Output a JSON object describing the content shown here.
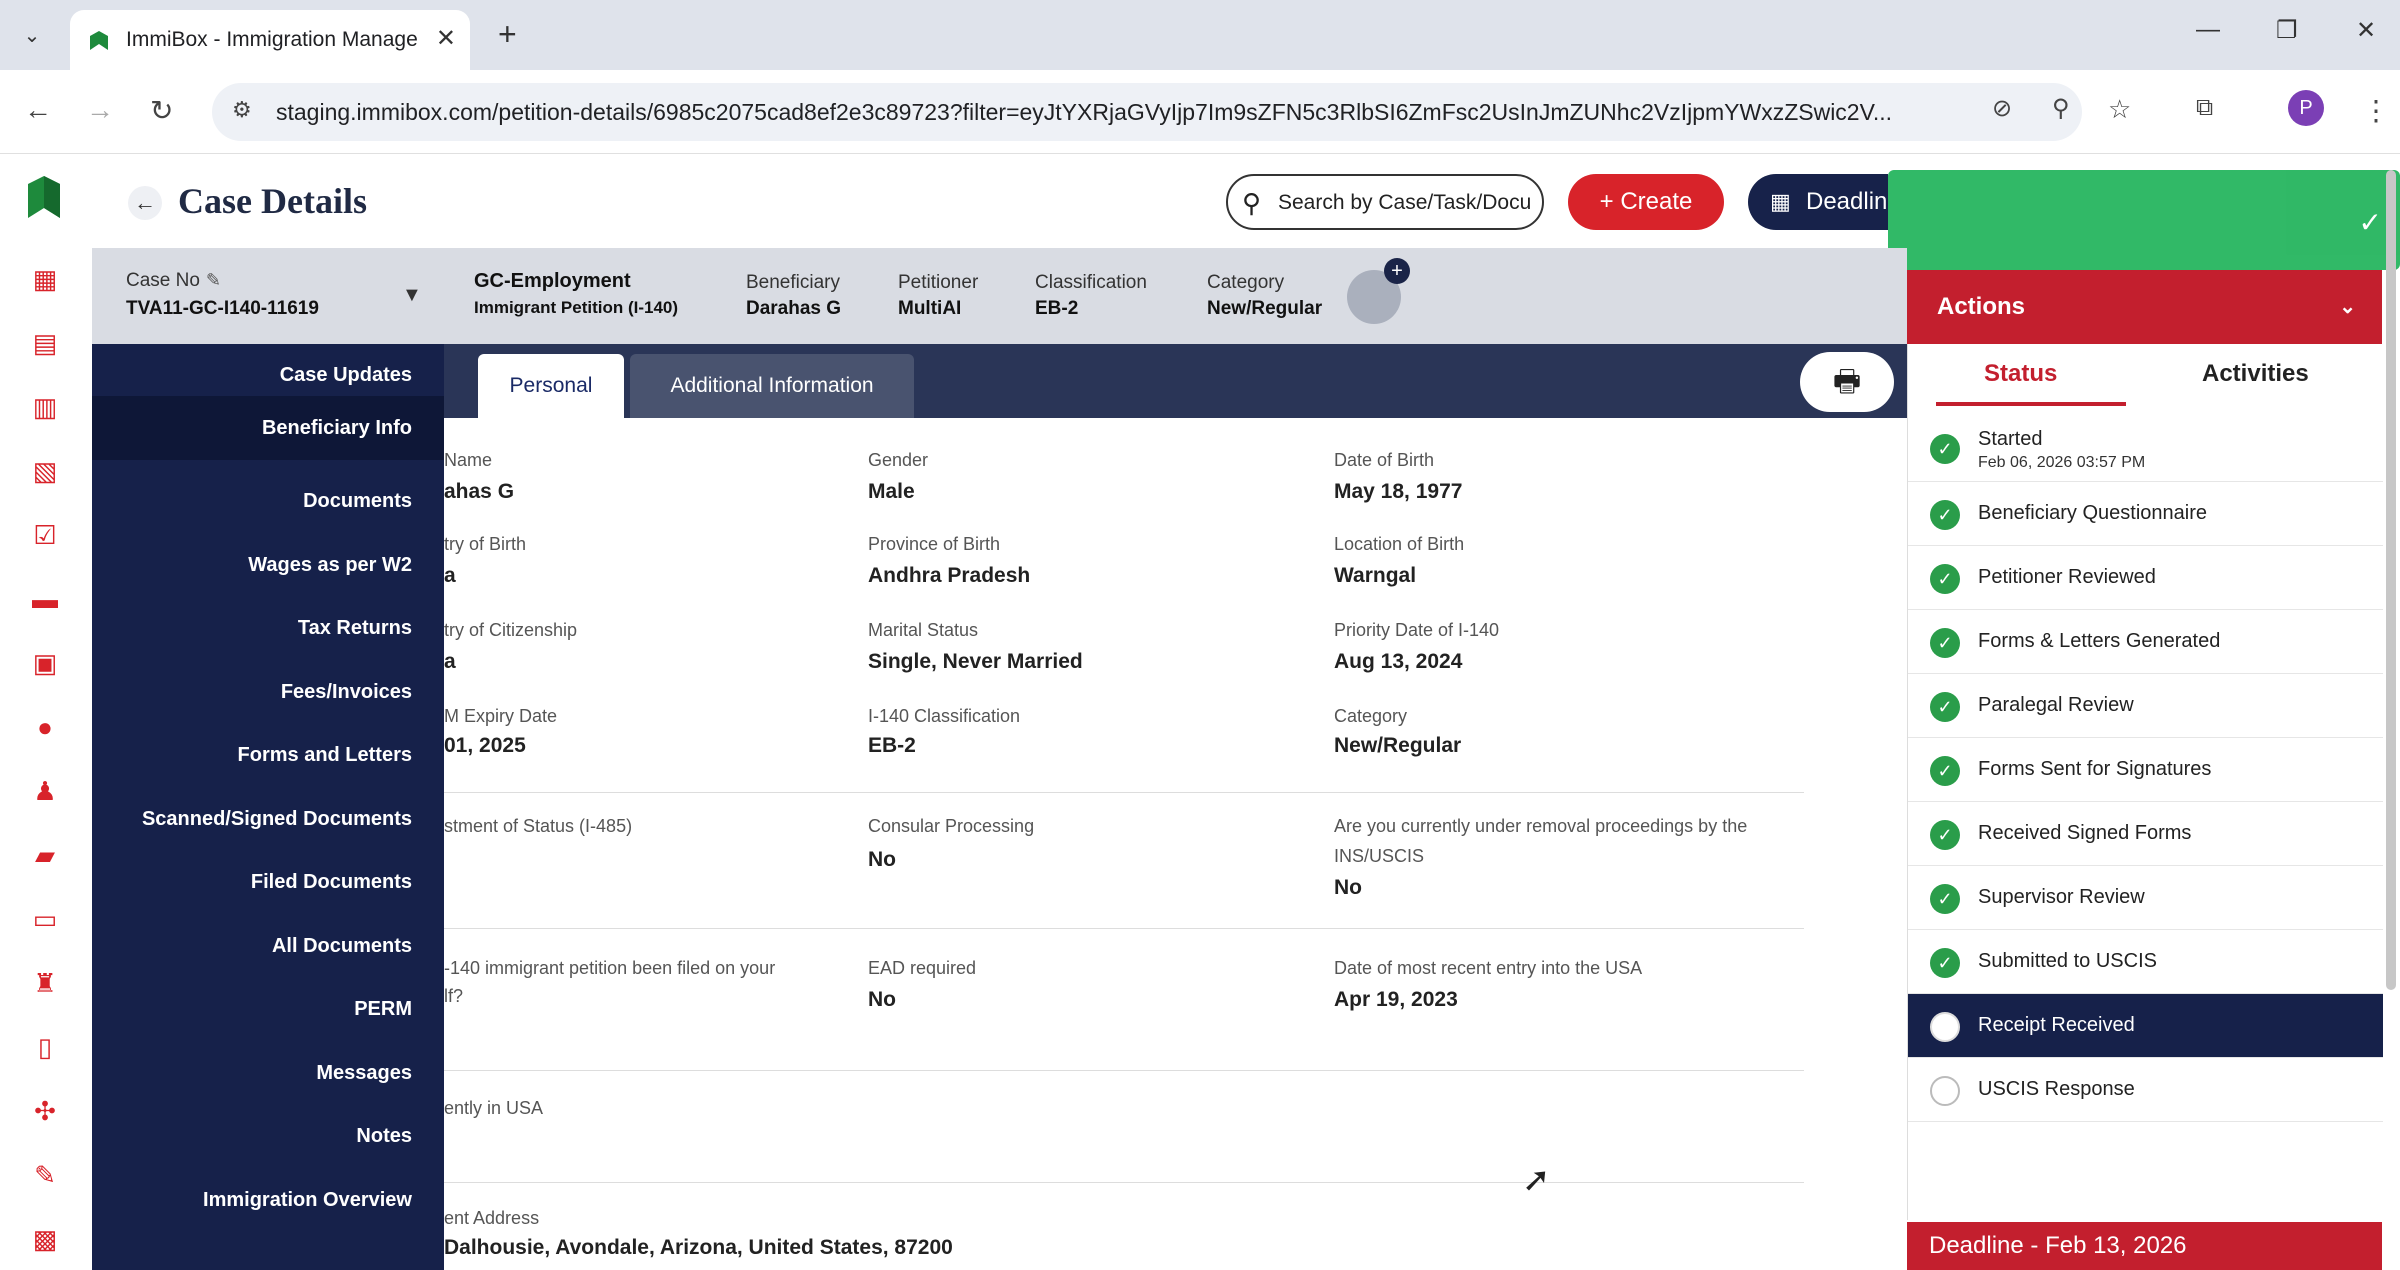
{
  "browser": {
    "tab_title": "ImmiBox - Immigration Manage",
    "url": "staging.immibox.com/petition-details/6985c2075cad8ef2e3c89723?filter=eyJtYXRjaGVyIjp7Im9sZFN5c3RlbSI6ZmFsc2UsInJmZUNhc2VzIjpmYWxzZSwic2V...",
    "profile_initial": "P"
  },
  "header": {
    "title": "Case Details",
    "search_placeholder": "Search by Case/Task/Docu",
    "create_label": "Create",
    "deadline_label": "Deadlin"
  },
  "case_info": {
    "case_no_label": "Case No",
    "case_no": "TVA11-GC-I140-11619",
    "case_type": "GC-Employment",
    "case_subtype": "Immigrant Petition (I-140)",
    "beneficiary_label": "Beneficiary",
    "beneficiary": "Darahas G",
    "petitioner_label": "Petitioner",
    "petitioner": "MultiAI",
    "classification_label": "Classification",
    "classification": "EB-2",
    "category_label": "Category",
    "category": "New/Regular"
  },
  "drawer": {
    "items": [
      "Case Updates",
      "Beneficiary Info",
      "Documents",
      "Wages as per W2",
      "Tax Returns",
      "Fees/Invoices",
      "Forms and Letters",
      "Scanned/Signed Documents",
      "Filed Documents",
      "All Documents",
      "PERM",
      "Messages",
      "Notes",
      "Immigration Overview"
    ]
  },
  "tabs": {
    "personal": "Personal",
    "additional": "Additional Information"
  },
  "fields": {
    "name_label": "Name",
    "name": "ahas G",
    "gender_label": "Gender",
    "gender": "Male",
    "dob_label": "Date of Birth",
    "dob": "May 18, 1977",
    "country_birth_label": "try of Birth",
    "country_birth": "a",
    "province_label": "Province of Birth",
    "province": "Andhra Pradesh",
    "location_label": "Location of Birth",
    "location": "Warngal",
    "citizenship_label": "try of Citizenship",
    "citizenship": "a",
    "marital_label": "Marital Status",
    "marital": "Single, Never Married",
    "priority_label": "Priority Date of I-140",
    "priority": "Aug 13, 2024",
    "expiry_label": "M Expiry Date",
    "expiry": "01, 2025",
    "i140_class_label": "I-140 Classification",
    "i140_class": "EB-2",
    "category_label": "Category",
    "category": "New/Regular",
    "adjustment_label": "stment of Status (I-485)",
    "consular_label": "Consular Processing",
    "consular": "No",
    "removal_label_1": "Are you currently under removal proceedings by the",
    "removal_label_2": "INS/USCIS",
    "removal": "No",
    "filed_label_1": "-140 immigrant petition been filed on your",
    "filed_label_2": "lf?",
    "ead_label": "EAD required",
    "ead": "No",
    "entry_label": "Date of most recent entry into the USA",
    "entry": "Apr 19, 2023",
    "in_usa_label": "ently in USA",
    "address_label": "ent Address",
    "address": "Dalhousie, Avondale, Arizona, United States, 87200"
  },
  "actions": {
    "title": "Actions",
    "status_tab": "Status",
    "activities_tab": "Activities",
    "steps": [
      {
        "label": "Started",
        "sub": "Feb 06, 2026 03:57 PM",
        "state": "done"
      },
      {
        "label": "Beneficiary Questionnaire",
        "state": "done"
      },
      {
        "label": "Petitioner Reviewed",
        "state": "done"
      },
      {
        "label": "Forms & Letters Generated",
        "state": "done"
      },
      {
        "label": "Paralegal Review",
        "state": "done"
      },
      {
        "label": "Forms Sent for Signatures",
        "state": "done"
      },
      {
        "label": "Received Signed Forms",
        "state": "done"
      },
      {
        "label": "Supervisor Review",
        "state": "done"
      },
      {
        "label": "Submitted to USCIS",
        "state": "done"
      },
      {
        "label": "Receipt Received",
        "state": "current"
      },
      {
        "label": "USCIS Response",
        "state": "pending"
      }
    ],
    "deadline": "Deadline - Feb 13, 2026"
  },
  "colors": {
    "brand_red": "#d8232a",
    "navy": "#16214a",
    "success_green": "#2a9d4a"
  }
}
